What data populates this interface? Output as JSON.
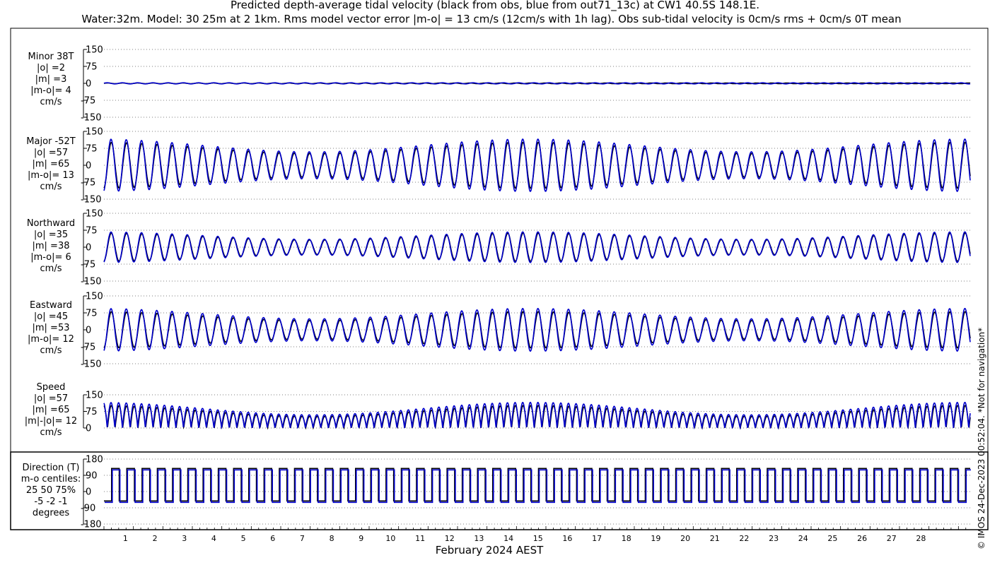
{
  "title_line1": "Predicted depth-average tidal velocity (black from obs, blue from out71_13c) at CW1 40.5S 148.1E.",
  "title_line2": "Water:32m. Model: 30 25m at 2 1km. Rms model vector error |m-o| = 13 cm/s (12cm/s with 1h lag). Obs sub-tidal velocity is 0cm/s rms + 0cm/s 0T mean",
  "side_note": "© IMOS 24-Dec-2023 00:52:04. *Not for navigation*",
  "colors": {
    "obs": "#000000",
    "model": "#0000cc",
    "grid": "#555555"
  },
  "chart_data": {
    "type": "line",
    "xlabel": "February 2024 AEST",
    "x_ticks": [
      "1",
      "2",
      "3",
      "4",
      "5",
      "6",
      "7",
      "8",
      "9",
      "10",
      "11",
      "12",
      "13",
      "14",
      "15",
      "16",
      "17",
      "18",
      "19",
      "20",
      "21",
      "22",
      "23",
      "24",
      "25",
      "26",
      "27",
      "28"
    ],
    "xlim_days": [
      0,
      29.4
    ],
    "series_names": [
      "obs",
      "model"
    ],
    "panels": [
      {
        "id": "minor",
        "labels": [
          "Minor 38T",
          "|o| =2",
          "|m| =3",
          "|m-o|= 4",
          "cm/s"
        ],
        "yticks": [
          "150",
          "75",
          "0",
          "-75",
          "-150"
        ],
        "ylim": [
          -150,
          150
        ],
        "series": {
          "obs_amp": 2,
          "model_amp": 3
        }
      },
      {
        "id": "major",
        "labels": [
          "Major -52T",
          "|o| =57",
          "|m| =65",
          "|m-o|= 13",
          "cm/s"
        ],
        "yticks": [
          "150",
          "75",
          "0",
          "-75",
          "-150"
        ],
        "ylim": [
          -150,
          150
        ],
        "series": {
          "obs_amp": 57,
          "model_amp": 65
        }
      },
      {
        "id": "northward",
        "labels": [
          "Northward",
          "|o| =35",
          "|m| =38",
          "|m-o|= 6",
          "cm/s"
        ],
        "yticks": [
          "150",
          "75",
          "0",
          "-75",
          "-150"
        ],
        "ylim": [
          -150,
          150
        ],
        "series": {
          "obs_amp": 35,
          "model_amp": 38
        }
      },
      {
        "id": "eastward",
        "labels": [
          "Eastward",
          "|o| =45",
          "|m| =53",
          "|m-o|= 12",
          "cm/s"
        ],
        "yticks": [
          "150",
          "75",
          "0",
          "-75",
          "-150"
        ],
        "ylim": [
          -150,
          150
        ],
        "series": {
          "obs_amp": 45,
          "model_amp": 53
        }
      },
      {
        "id": "speed",
        "labels": [
          "Speed",
          "|o| =57",
          "|m| =65",
          "|m|-|o|= 12",
          "cm/s"
        ],
        "yticks": [
          "150",
          "75",
          "0"
        ],
        "ylim": [
          0,
          150
        ],
        "series": {
          "obs_amp": 57,
          "model_amp": 65
        }
      },
      {
        "id": "direction",
        "labels": [
          "Direction (T)",
          "m-o centiles:",
          "25  50  75%",
          "-5 -2 -1",
          "degrees"
        ],
        "yticks": [
          "180",
          "90",
          "0",
          "-90",
          "-180"
        ],
        "ylim": [
          -180,
          180
        ],
        "series": {
          "flood_deg": 128,
          "ebb_deg": -52
        }
      }
    ]
  }
}
